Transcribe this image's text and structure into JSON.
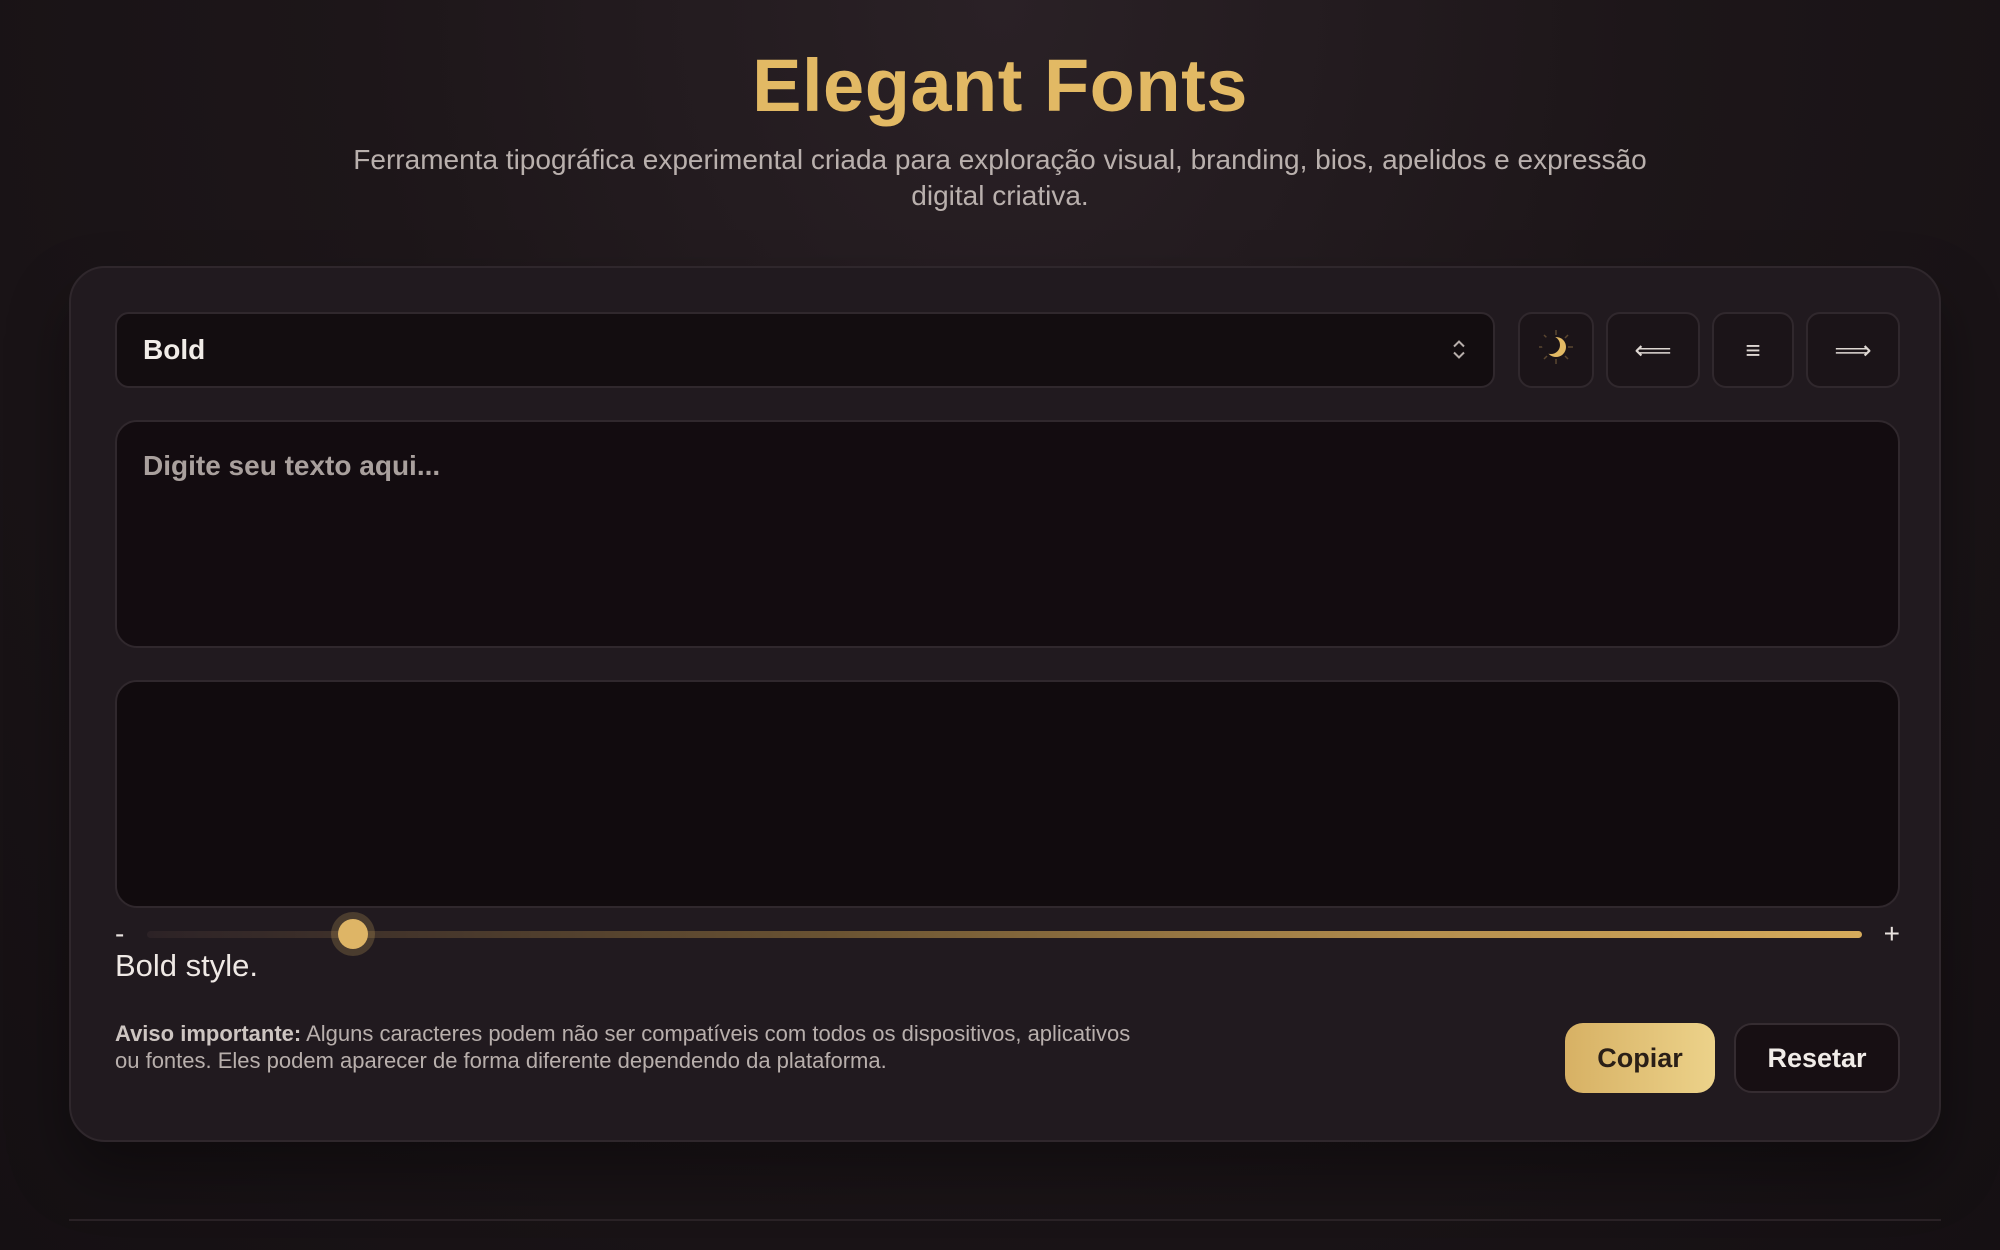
{
  "header": {
    "title": "Elegant Fonts",
    "subtitle": "Ferramenta tipográfica experimental criada para exploração visual, branding, bios, apelidos e expressão digital criativa."
  },
  "toolbar": {
    "style_select_value": "Bold",
    "theme_icon": "moon-icon",
    "align_left_glyph": "⟸",
    "align_center_glyph": "≡",
    "align_right_glyph": "⟹"
  },
  "input": {
    "placeholder": "Digite seu texto aqui...",
    "value": ""
  },
  "output": {
    "value": ""
  },
  "slider": {
    "minus_label": "-",
    "plus_label": "+",
    "level_fraction": 0.12
  },
  "caption": "Bold style.",
  "notice": {
    "label": "Aviso importante:",
    "text": " Alguns caracteres podem não ser compatíveis com todos os dispositivos, aplicativos ou fontes. Eles podem aparecer de forma diferente dependendo da plataforma."
  },
  "actions": {
    "copy_label": "Copiar",
    "reset_label": "Resetar"
  },
  "colors": {
    "accent": "#e2b964",
    "background": "#1a1317",
    "card": "#211a1f"
  }
}
